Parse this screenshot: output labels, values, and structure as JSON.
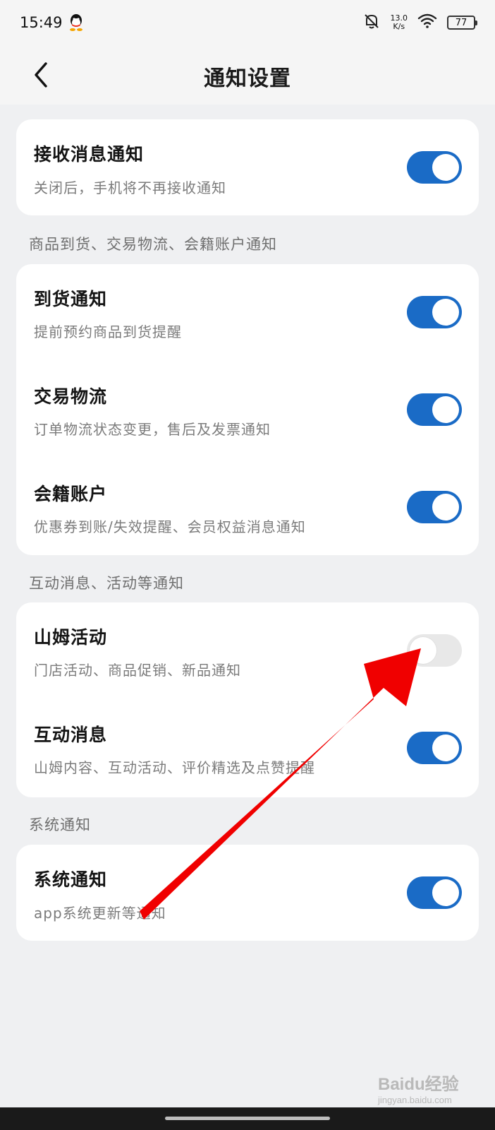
{
  "status_bar": {
    "time": "15:49",
    "net_speed_value": "13.0",
    "net_speed_unit": "K/s",
    "battery": "77",
    "icons": [
      "qq-icon",
      "bell-off-icon",
      "wifi-icon",
      "battery-icon"
    ]
  },
  "header": {
    "title": "通知设置",
    "back_icon": "chevron-left-icon"
  },
  "master": {
    "title": "接收消息通知",
    "subtitle": "关闭后，手机将不再接收通知",
    "enabled": true
  },
  "sections": [
    {
      "label": "商品到货、交易物流、会籍账户通知",
      "items": [
        {
          "title": "到货通知",
          "subtitle": "提前预约商品到货提醒",
          "enabled": true
        },
        {
          "title": "交易物流",
          "subtitle": "订单物流状态变更，售后及发票通知",
          "enabled": true
        },
        {
          "title": "会籍账户",
          "subtitle": "优惠券到账/失效提醒、会员权益消息通知",
          "enabled": true
        }
      ]
    },
    {
      "label": "互动消息、活动等通知",
      "items": [
        {
          "title": "山姆活动",
          "subtitle": "门店活动、商品促销、新品通知",
          "enabled": false
        },
        {
          "title": "互动消息",
          "subtitle": "山姆内容、互动活动、评价精选及点赞提醒",
          "enabled": true
        }
      ]
    },
    {
      "label": "系统通知",
      "items": [
        {
          "title": "系统通知",
          "subtitle": "app系统更新等通知",
          "enabled": true
        }
      ]
    }
  ],
  "watermark": "Baidu经验",
  "watermark_sub": "jingyan.baidu.com",
  "colors": {
    "toggle_on": "#1a6bc6",
    "toggle_off": "#e8e8e8",
    "annotation_arrow": "#f00000"
  }
}
